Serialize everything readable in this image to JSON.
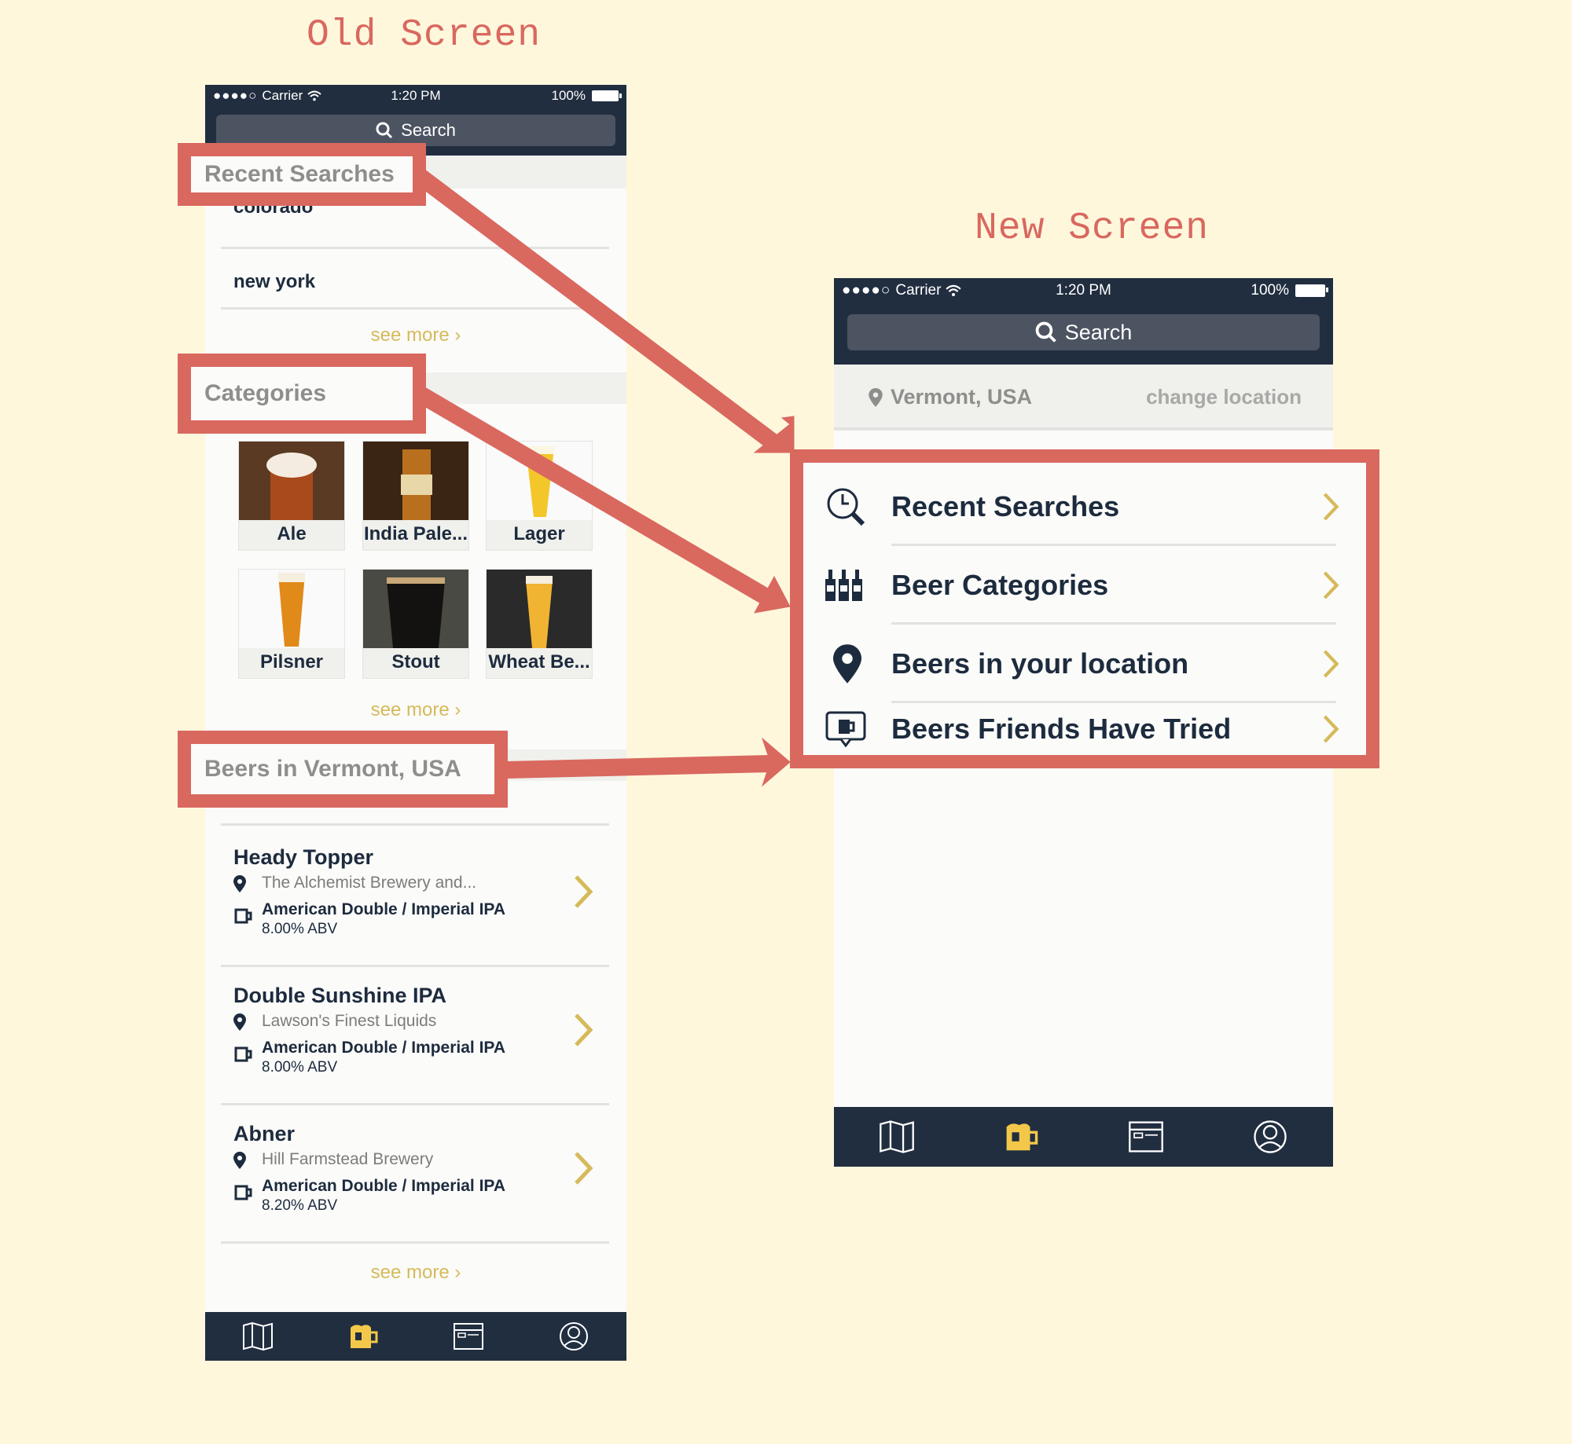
{
  "headings": {
    "old": "Old Screen",
    "new": "New Screen"
  },
  "colors": {
    "accent": "#d9685f",
    "navy": "#212e40",
    "gold": "#d6ba5a",
    "background": "#fef7dc"
  },
  "status_bar": {
    "carrier": "Carrier",
    "time": "1:20 PM",
    "battery": "100%"
  },
  "search": {
    "label": "Search"
  },
  "old_screen": {
    "recent_searches": {
      "title": "Recent Searches",
      "items": [
        "colorado",
        "new york"
      ],
      "see_more": "see more"
    },
    "categories": {
      "title": "Categories",
      "items": [
        "Ale",
        "India Pale...",
        "Lager",
        "Pilsner",
        "Stout",
        "Wheat Be..."
      ],
      "see_more": "see more"
    },
    "beers_section": {
      "title": "Beers in Vermont, USA",
      "beers": [
        {
          "name": "Heady Topper",
          "brewery": "The Alchemist Brewery and...",
          "style": "American Double / Imperial IPA",
          "abv": "8.00% ABV"
        },
        {
          "name": "Double Sunshine IPA",
          "brewery": "Lawson's Finest Liquids",
          "style": "American Double / Imperial IPA",
          "abv": "8.00% ABV"
        },
        {
          "name": "Abner",
          "brewery": "Hill Farmstead Brewery",
          "style": "American Double / Imperial IPA",
          "abv": "8.20% ABV"
        }
      ],
      "see_more": "see more"
    }
  },
  "new_screen": {
    "location": {
      "name": "Vermont, USA",
      "change": "change location"
    },
    "menu": [
      {
        "label": "Recent Searches",
        "icon": "clock-search-icon"
      },
      {
        "label": "Beer Categories",
        "icon": "bottles-icon"
      },
      {
        "label": "Beers in your location",
        "icon": "location-pin-icon"
      },
      {
        "label": "Beers Friends Have Tried",
        "icon": "friends-beer-icon"
      }
    ]
  },
  "tab_bar": {
    "tabs": [
      "map-icon",
      "beer-mug-icon",
      "news-icon",
      "profile-icon"
    ],
    "active": "beer-mug-icon"
  }
}
